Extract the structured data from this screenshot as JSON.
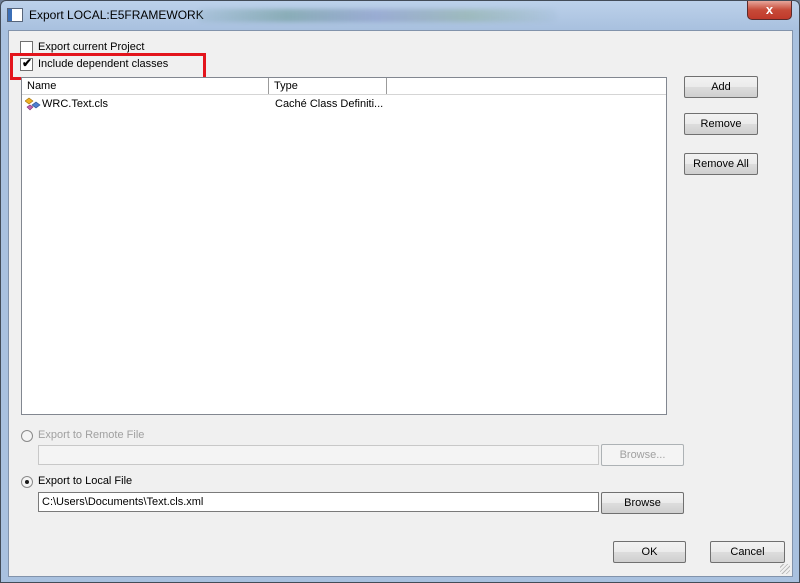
{
  "window": {
    "title": "Export  LOCAL:E5FRAMEWORK",
    "close_label": "x"
  },
  "options": {
    "export_current_project": {
      "label": "Export current Project",
      "checked": false
    },
    "include_dependent_classes": {
      "label": "Include dependent classes",
      "checked": true
    }
  },
  "list": {
    "columns": [
      "Name",
      "Type"
    ],
    "rows": [
      {
        "name": "WRC.Text.cls",
        "type": "Caché Class Definiti...",
        "icon": "class-file-icon"
      }
    ]
  },
  "side_buttons": {
    "add": "Add",
    "remove": "Remove",
    "remove_all": "Remove All"
  },
  "remote": {
    "label": "Export to Remote File",
    "value": "",
    "browse": "Browse...",
    "selected": false,
    "enabled": false
  },
  "local": {
    "label": "Export to Local File",
    "value": "C:\\Users\\Documents\\Text.cls.xml",
    "browse": "Browse",
    "selected": true
  },
  "footer": {
    "ok": "OK",
    "cancel": "Cancel"
  },
  "colors": {
    "highlight_box": "#e3141c",
    "title_bar": "#a9c1df",
    "close_button": "#c74a38"
  }
}
